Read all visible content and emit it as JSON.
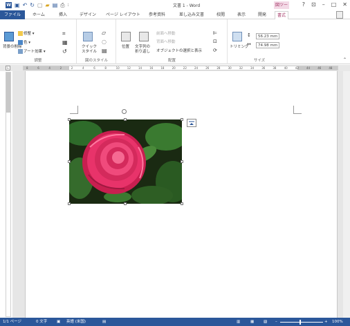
{
  "window": {
    "title": "文書 1 - Word",
    "context_tab_header": "図ツー",
    "controls": [
      "?",
      "⊡",
      "–",
      "□",
      "✕"
    ]
  },
  "qat": {
    "logo": "W"
  },
  "tabs": [
    {
      "label": "ファイル"
    },
    {
      "label": "ホーム"
    },
    {
      "label": "挿入"
    },
    {
      "label": "デザイン"
    },
    {
      "label": "ページ レイアウト"
    },
    {
      "label": "参考資料"
    },
    {
      "label": "差し込み文書"
    },
    {
      "label": "校閲"
    },
    {
      "label": "表示"
    },
    {
      "label": "開発"
    },
    {
      "label": "書式"
    }
  ],
  "ribbon": {
    "adjust": {
      "label": "調整",
      "remove_bg": "背景の削除",
      "corrections": "修整",
      "color": "色",
      "art_effects": "アート効果"
    },
    "styles": {
      "label": "図のスタイル",
      "quick_styles_line1": "クイック",
      "quick_styles_line2": "スタイル"
    },
    "arrange": {
      "label": "配置",
      "position": "位置",
      "wrap_line1": "文字列の",
      "wrap_line2": "折り返し",
      "bring_forward": "前面へ移動",
      "send_backward": "背面へ移動",
      "selection_pane": "オブジェクトの選択と表示"
    },
    "size": {
      "label": "サイズ",
      "crop": "トリミング",
      "height": "56.23 mm",
      "width": "74.98 mm"
    }
  },
  "ruler": {
    "corner": "L",
    "ticks": [
      "8",
      "6",
      "4",
      "2",
      "2",
      "4",
      "6",
      "8",
      "10",
      "12",
      "14",
      "16",
      "18",
      "20",
      "22",
      "24",
      "26",
      "28",
      "30",
      "32",
      "34",
      "36",
      "38",
      "40",
      "42",
      "44",
      "46",
      "48"
    ]
  },
  "statusbar": {
    "page": "1/1 ページ",
    "words": "0 文字",
    "language": "英語 (米国)",
    "zoom": "100%"
  },
  "colors": {
    "word_blue": "#2b579a",
    "context_pink": "#a03060",
    "flower_pink": "#e8336a",
    "leaf_green": "#2e6b2a"
  }
}
